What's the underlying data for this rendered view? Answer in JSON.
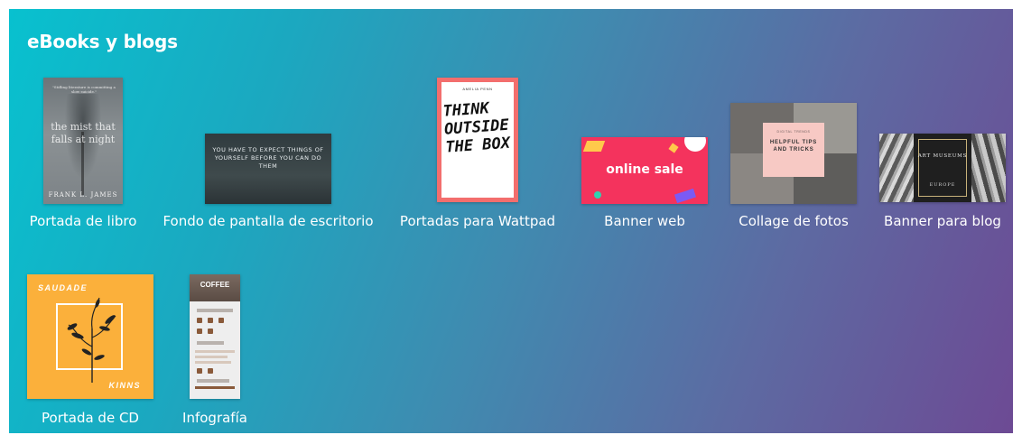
{
  "section": {
    "title": "eBooks y blogs"
  },
  "templates": [
    {
      "label": "Portada de libro",
      "thumb": {
        "quote": "\"Stifling literature is committing a slow suicide.\"",
        "title": "the mist that falls at night",
        "author": "FRANK L. JAMES"
      }
    },
    {
      "label": "Fondo de pantalla de escritorio",
      "thumb": {
        "text": "YOU HAVE TO EXPECT THINGS OF YOURSELF BEFORE YOU CAN DO THEM"
      }
    },
    {
      "label": "Portadas para Wattpad",
      "thumb": {
        "top": "AMELIA PENN",
        "text": "THINK OUTSIDE THE BOX"
      }
    },
    {
      "label": "Banner web",
      "thumb": {
        "text": "online sale"
      }
    },
    {
      "label": "Collage de fotos",
      "thumb": {
        "top": "DIGITAL TRENDS",
        "text": "HELPFUL TIPS AND TRICKS"
      }
    },
    {
      "label": "Banner para blog",
      "thumb": {
        "text": "ART MUSEUMS",
        "sub": "EUROPE"
      }
    },
    {
      "label": "Portada de CD",
      "thumb": {
        "top": "SAUDADE",
        "bottom": "KINNS"
      }
    },
    {
      "label": "Infografía",
      "thumb": {
        "text": "COFFEE"
      }
    }
  ],
  "colors": {
    "gradient_start": "#08c1cf",
    "gradient_end": "#6d4a94",
    "book": "#7f868a",
    "wattpad_border": "#f36e6d",
    "banner": "#f4335d",
    "cd": "#fbb03b"
  }
}
